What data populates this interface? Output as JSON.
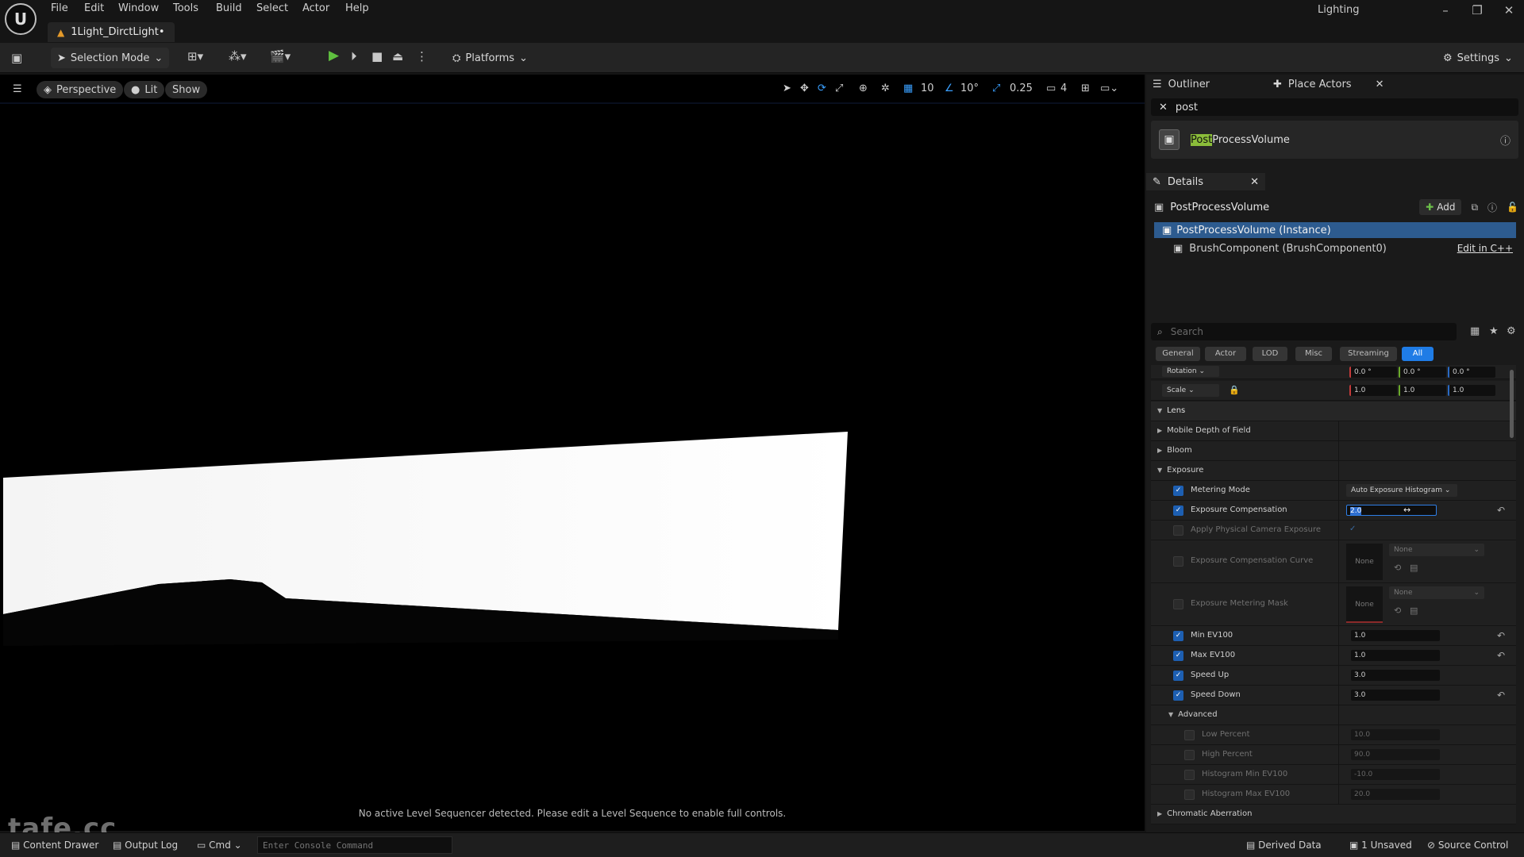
{
  "menu": [
    "File",
    "Edit",
    "Window",
    "Tools",
    "Build",
    "Select",
    "Actor",
    "Help"
  ],
  "document_tab": "1Light_DirctLight•",
  "project_name": "Lighting",
  "window_controls": {
    "minimize": "–",
    "restore": "❐",
    "close": "✕"
  },
  "toolbar": {
    "selection_mode": "Selection Mode",
    "platforms": "Platforms",
    "settings": "Settings"
  },
  "viewport": {
    "perspective": "Perspective",
    "lit": "Lit",
    "show": "Show",
    "grid_snap": "10",
    "rotation_snap": "10°",
    "scale_snap": "0.25",
    "camera_speed": "4",
    "sequencer_message": "No active Level Sequencer detected. Please edit a Level Sequence to enable full controls.",
    "watermark": "tafe.cc"
  },
  "bottom_bar": {
    "content_drawer": "Content Drawer",
    "output_log": "Output Log",
    "cmd": "Cmd",
    "console_placeholder": "Enter Console Command",
    "derived_data": "Derived Data",
    "unsaved": "1 Unsaved",
    "source_control": "Source Control"
  },
  "outliner": {
    "tab": "Outliner",
    "place_actors_tab": "Place Actors",
    "search_value": "post",
    "result_highlight": "Post",
    "result_rest": "ProcessVolume"
  },
  "details": {
    "tab": "Details",
    "actor_name": "PostProcessVolume",
    "add_label": "Add",
    "instance_label": "PostProcessVolume (Instance)",
    "brush_component": "BrushComponent (BrushComponent0)",
    "edit_cpp": "Edit in C++",
    "search_placeholder": "Search",
    "filters": [
      "General",
      "Actor",
      "LOD",
      "Misc",
      "Streaming",
      "All"
    ],
    "transform": {
      "rotation_label": "Rotation",
      "rotation": [
        "0.0 °",
        "0.0 °",
        "0.0 °"
      ],
      "scale_label": "Scale",
      "scale": [
        "1.0",
        "1.0",
        "1.0"
      ]
    },
    "sections": {
      "lens": "Lens",
      "mobile_dof": "Mobile Depth of Field",
      "bloom": "Bloom",
      "exposure": "Exposure",
      "advanced": "Advanced",
      "chromatic": "Chromatic Aberration"
    },
    "exposure": {
      "metering_mode_label": "Metering Mode",
      "metering_mode_value": "Auto Exposure Histogram",
      "compensation_label": "Exposure Compensation",
      "compensation_value": "2.0",
      "physical_camera_label": "Apply Physical Camera Exposure",
      "comp_curve_label": "Exposure Compensation Curve",
      "comp_curve_thumb": "None",
      "comp_curve_value": "None",
      "metering_mask_label": "Exposure Metering Mask",
      "metering_mask_thumb": "None",
      "metering_mask_value": "None",
      "min_ev_label": "Min EV100",
      "min_ev_value": "1.0",
      "max_ev_label": "Max EV100",
      "max_ev_value": "1.0",
      "speed_up_label": "Speed Up",
      "speed_up_value": "3.0",
      "speed_down_label": "Speed Down",
      "speed_down_value": "3.0"
    },
    "advanced": {
      "low_percent_label": "Low Percent",
      "low_percent_value": "10.0",
      "high_percent_label": "High Percent",
      "high_percent_value": "90.0",
      "hist_min_label": "Histogram Min EV100",
      "hist_min_value": "-10.0",
      "hist_max_label": "Histogram Max EV100",
      "hist_max_value": "20.0"
    }
  }
}
